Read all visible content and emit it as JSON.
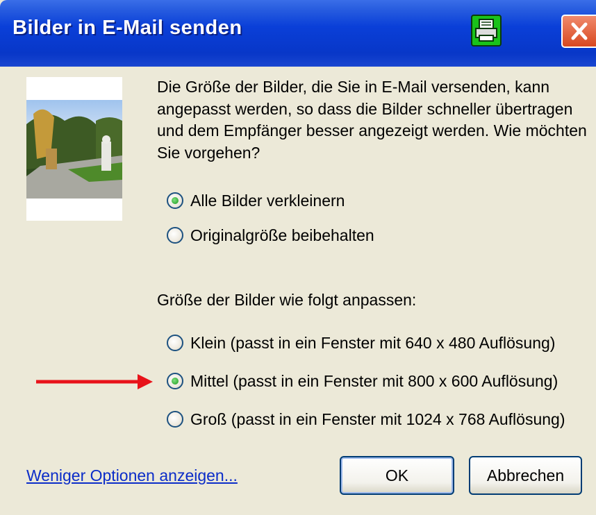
{
  "window": {
    "title": "Bilder in E-Mail senden"
  },
  "dialog": {
    "description": "Die Größe der Bilder, die Sie in E-Mail versenden, kann angepasst werden, so dass die Bilder schneller übertragen und dem Empfänger besser angezeigt werden. Wie möchten Sie vorgehen?",
    "mode_options": [
      {
        "label": "Alle Bilder verkleinern",
        "checked": true
      },
      {
        "label": "Originalgröße beibehalten",
        "checked": false
      }
    ],
    "size_label": "Größe der Bilder wie folgt anpassen:",
    "size_options": [
      {
        "label": "Klein (passt in ein Fenster mit 640 x 480 Auflösung)",
        "checked": false
      },
      {
        "label": "Mittel (passt in ein Fenster mit 800 x 600 Auflösung)",
        "checked": true
      },
      {
        "label": "Groß (passt in ein Fenster mit 1024 x 768 Auflösung)",
        "checked": false
      }
    ],
    "less_options_link": "Weniger Optionen anzeigen...",
    "ok_label": "OK",
    "cancel_label": "Abbrechen"
  },
  "colors": {
    "titlebar": "#0a3fd8",
    "dialog_bg": "#ece9d8",
    "arrow": "#e8131a",
    "link": "#0b2cc8"
  },
  "icons": [
    "printer-icon",
    "close-icon",
    "arrow-icon"
  ]
}
